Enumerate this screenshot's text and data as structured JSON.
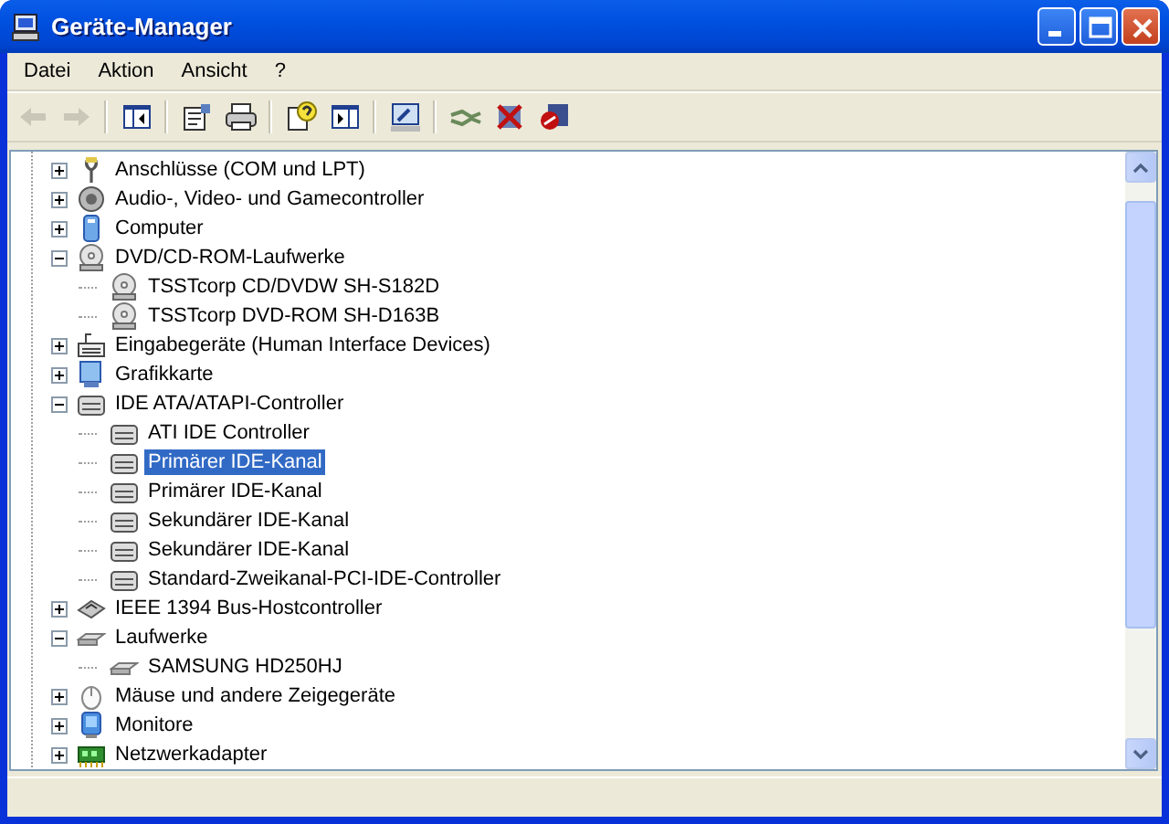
{
  "window": {
    "title": "Geräte-Manager"
  },
  "menu": [
    "Datei",
    "Aktion",
    "Ansicht",
    "?"
  ],
  "toolbar": [
    {
      "kind": "back",
      "disabled": true
    },
    {
      "kind": "forward",
      "disabled": true
    },
    {
      "kind": "separator"
    },
    {
      "kind": "tree-pane"
    },
    {
      "kind": "separator"
    },
    {
      "kind": "properties"
    },
    {
      "kind": "print"
    },
    {
      "kind": "separator"
    },
    {
      "kind": "help"
    },
    {
      "kind": "action-pane"
    },
    {
      "kind": "separator"
    },
    {
      "kind": "scan"
    },
    {
      "kind": "separator"
    },
    {
      "kind": "update"
    },
    {
      "kind": "uninstall"
    },
    {
      "kind": "disable"
    }
  ],
  "tree": [
    {
      "label": "Anschlüsse (COM und LPT)",
      "kind": "port",
      "expanded": false,
      "selected": false
    },
    {
      "label": "Audio-, Video- und Gamecontroller",
      "kind": "audio",
      "expanded": false,
      "selected": false
    },
    {
      "label": "Computer",
      "kind": "computer",
      "expanded": false,
      "selected": false
    },
    {
      "label": "DVD/CD-ROM-Laufwerke",
      "kind": "cdrom",
      "expanded": true,
      "selected": false,
      "children": [
        {
          "label": "TSSTcorp CD/DVDW SH-S182D",
          "kind": "cdrom",
          "selected": false
        },
        {
          "label": "TSSTcorp DVD-ROM SH-D163B",
          "kind": "cdrom",
          "selected": false
        }
      ]
    },
    {
      "label": "Eingabegeräte (Human Interface Devices)",
      "kind": "input",
      "expanded": false,
      "selected": false
    },
    {
      "label": "Grafikkarte",
      "kind": "display",
      "expanded": false,
      "selected": false
    },
    {
      "label": "IDE ATA/ATAPI-Controller",
      "kind": "ide",
      "expanded": true,
      "selected": false,
      "children": [
        {
          "label": "ATI IDE Controller",
          "kind": "ide",
          "selected": false
        },
        {
          "label": "Primärer IDE-Kanal",
          "kind": "ide",
          "selected": true
        },
        {
          "label": "Primärer IDE-Kanal",
          "kind": "ide",
          "selected": false
        },
        {
          "label": "Sekundärer IDE-Kanal",
          "kind": "ide",
          "selected": false
        },
        {
          "label": "Sekundärer IDE-Kanal",
          "kind": "ide",
          "selected": false
        },
        {
          "label": "Standard-Zweikanal-PCI-IDE-Controller",
          "kind": "ide",
          "selected": false
        }
      ]
    },
    {
      "label": "IEEE 1394 Bus-Hostcontroller",
      "kind": "firewire",
      "expanded": false,
      "selected": false
    },
    {
      "label": "Laufwerke",
      "kind": "disk",
      "expanded": true,
      "selected": false,
      "children": [
        {
          "label": "SAMSUNG HD250HJ",
          "kind": "disk",
          "selected": false
        }
      ]
    },
    {
      "label": "Mäuse und andere Zeigegeräte",
      "kind": "mouse",
      "expanded": false,
      "selected": false
    },
    {
      "label": "Monitore",
      "kind": "monitor",
      "expanded": false,
      "selected": false
    },
    {
      "label": "Netzwerkadapter",
      "kind": "network",
      "expanded": false,
      "selected": false
    }
  ]
}
